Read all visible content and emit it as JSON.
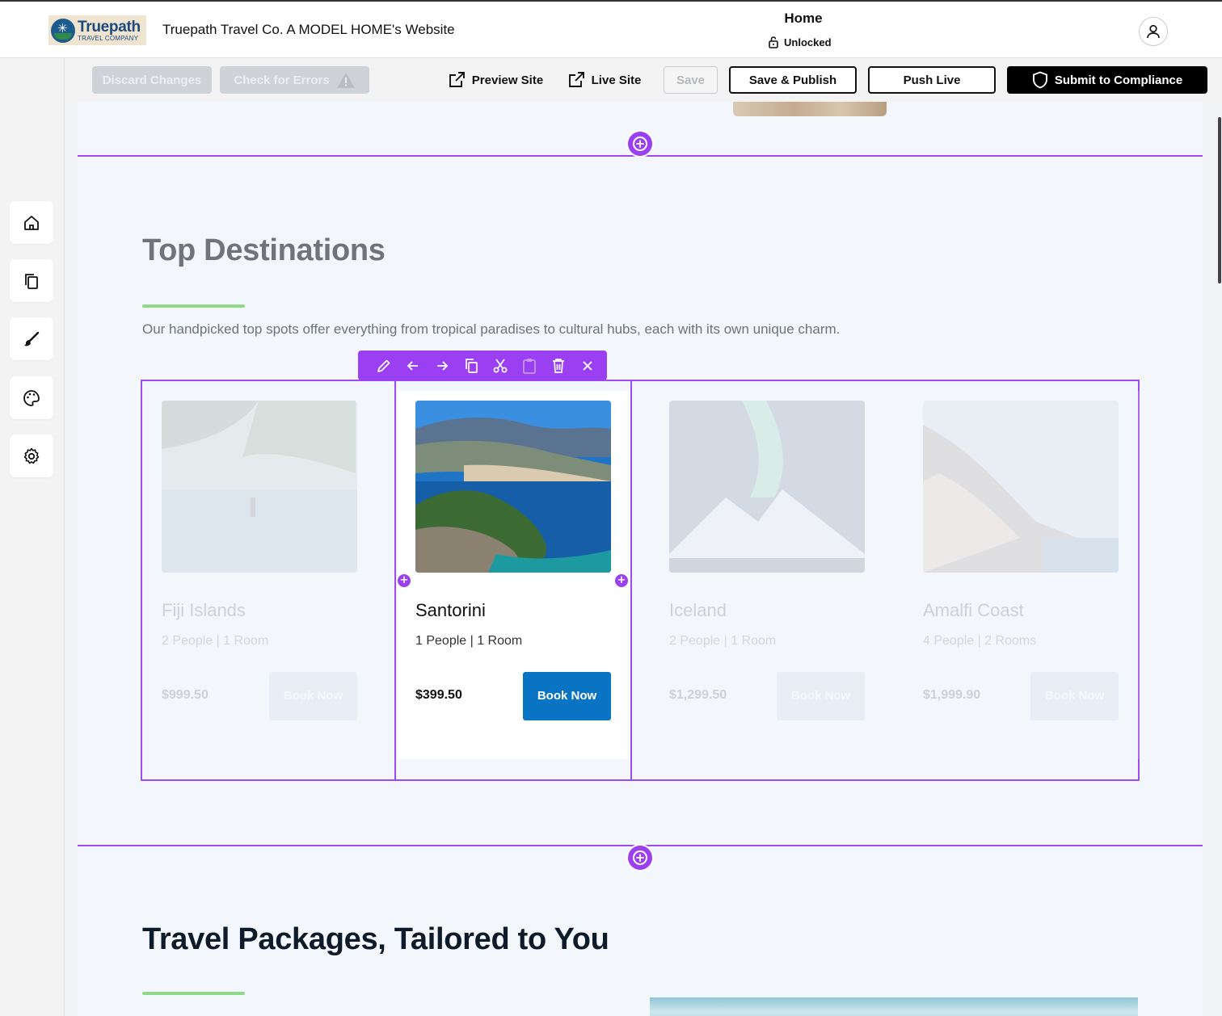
{
  "header": {
    "logo_name": "Truepath",
    "logo_sub": "TRAVEL COMPANY",
    "site_title": "Truepath Travel Co. A MODEL HOME's Website",
    "page_name": "Home",
    "lock_status": "Unlocked"
  },
  "toolbar": {
    "discard": "Discard Changes",
    "check_errors": "Check for Errors",
    "preview": "Preview Site",
    "live": "Live Site",
    "save": "Save",
    "save_publish": "Save & Publish",
    "push_live": "Push Live",
    "submit": "Submit to Compliance"
  },
  "sidebar": {
    "items": [
      "home-icon",
      "pages-icon",
      "brush-icon",
      "palette-icon",
      "gear-icon"
    ]
  },
  "destinations": {
    "title": "Top Destinations",
    "description": "Our handpicked top spots offer everything from tropical paradises to cultural hubs, each with its own unique charm.",
    "book_label": "Book Now",
    "cards": [
      {
        "name": "Fiji Islands",
        "meta": "2 People | 1 Room",
        "price": "$999.50"
      },
      {
        "name": "Santorini",
        "meta": "1 People | 1 Room",
        "price": "$399.50"
      },
      {
        "name": "Iceland",
        "meta": "2 People | 1 Room",
        "price": "$1,299.50"
      },
      {
        "name": "Amalfi Coast",
        "meta": "4 People | 2 Rooms",
        "price": "$1,999.90"
      }
    ]
  },
  "packages": {
    "title": "Travel Packages, Tailored to You"
  },
  "colors": {
    "accent_purple": "#9b3ff2",
    "book_blue": "#0a74c4",
    "accent_green": "#90d98b"
  }
}
